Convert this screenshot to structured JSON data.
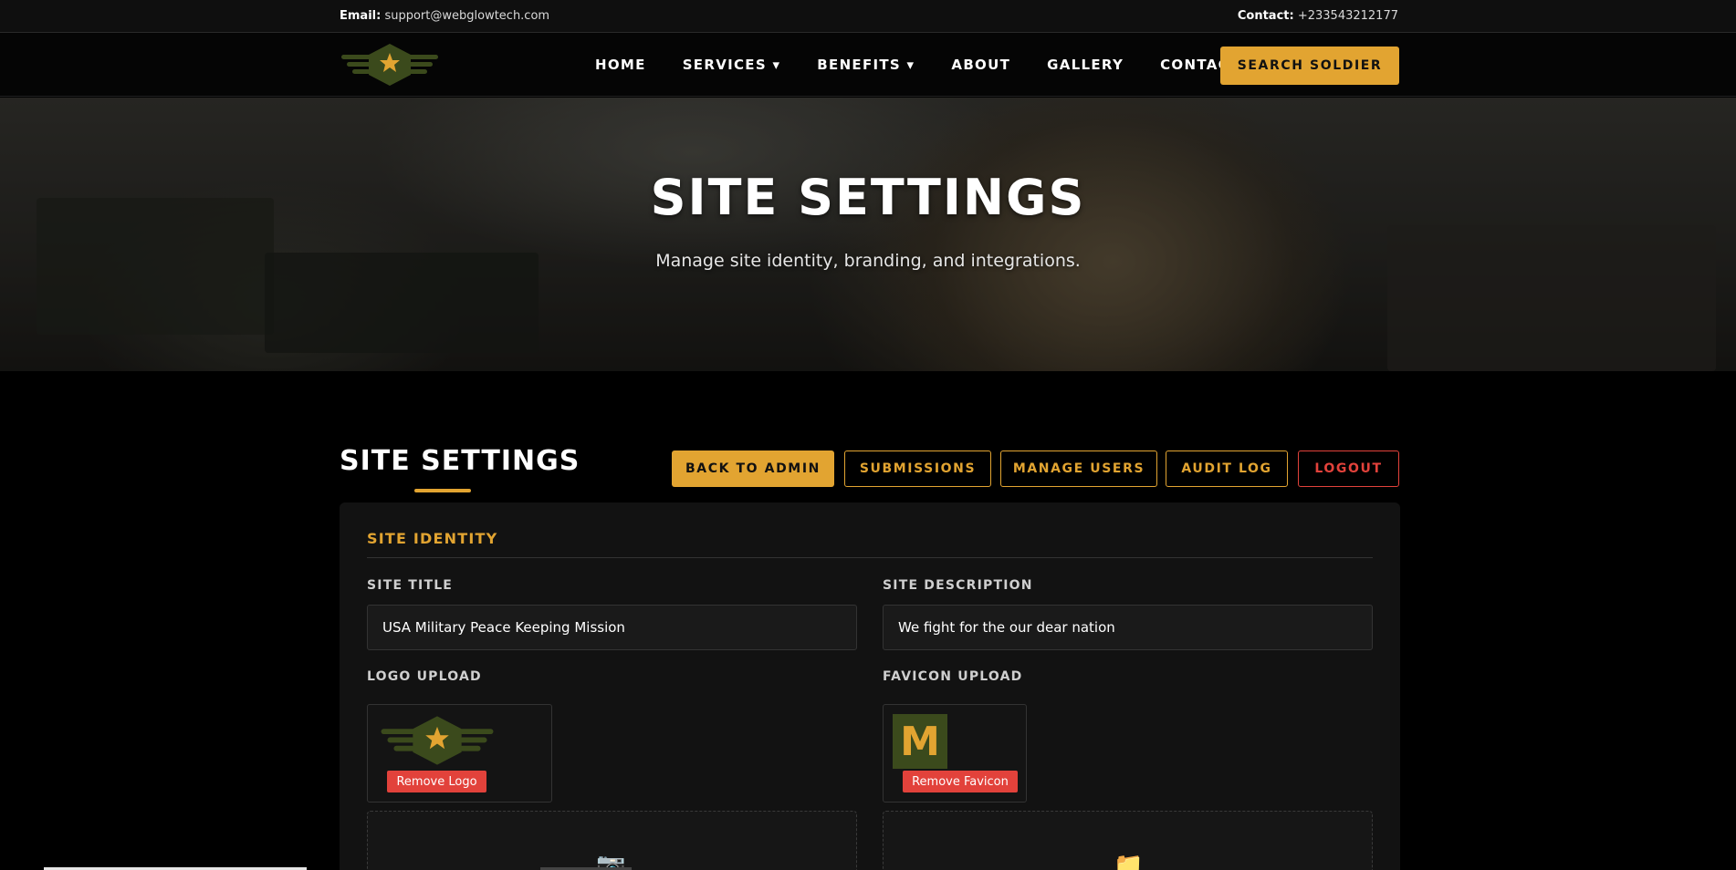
{
  "topbar": {
    "email_label": "Email:",
    "email_value": "support@webglowtech.com",
    "contact_label": "Contact:",
    "contact_value": "+233543212177"
  },
  "nav": {
    "items": [
      {
        "label": "HOME"
      },
      {
        "label": "SERVICES ▾"
      },
      {
        "label": "BENEFITS ▾"
      },
      {
        "label": "ABOUT"
      },
      {
        "label": "GALLERY"
      },
      {
        "label": "CONTACT"
      }
    ],
    "search_button": "SEARCH SOLDIER"
  },
  "hero": {
    "title": "SITE SETTINGS",
    "subtitle": "Manage site identity, branding, and integrations."
  },
  "settings": {
    "title": "SITE SETTINGS",
    "buttons": {
      "back": "BACK TO ADMIN",
      "submissions": "SUBMISSIONS",
      "users": "MANAGE USERS",
      "audit": "AUDIT LOG",
      "logout": "LOGOUT"
    }
  },
  "identity": {
    "section_title": "SITE IDENTITY",
    "site_title_label": "SITE TITLE",
    "site_title_value": "USA Military Peace Keeping Mission",
    "site_description_label": "SITE DESCRIPTION",
    "site_description_value": "We fight for the our dear nation",
    "logo_label": "LOGO UPLOAD",
    "remove_logo": "Remove Logo",
    "favicon_label": "FAVICON UPLOAD",
    "favicon_letter": "M",
    "remove_favicon": "Remove Favicon",
    "logo_drop_icon": "📷",
    "favicon_drop_icon": "📁"
  },
  "colors": {
    "accent": "#e2a431",
    "danger": "#e2423b",
    "logo_green": "#3b4a1c"
  }
}
